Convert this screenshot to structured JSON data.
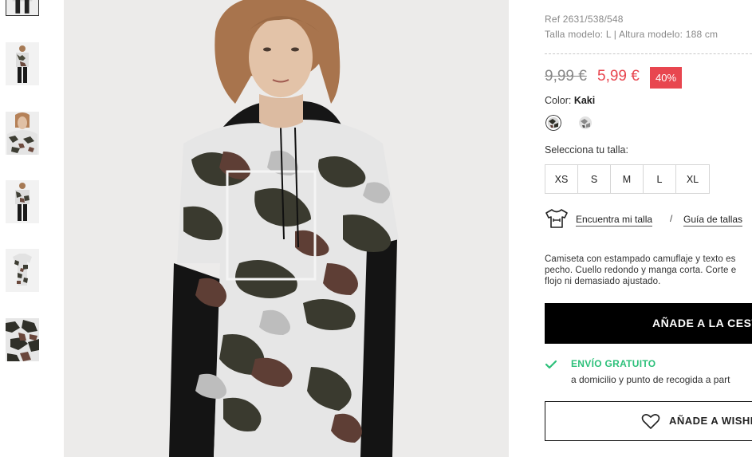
{
  "thumbnails": [
    {
      "name": "thumbnail-1",
      "active": true
    },
    {
      "name": "thumbnail-2",
      "active": false
    },
    {
      "name": "thumbnail-3",
      "active": false
    },
    {
      "name": "thumbnail-4",
      "active": false
    },
    {
      "name": "thumbnail-5",
      "active": false
    },
    {
      "name": "thumbnail-6",
      "active": false
    }
  ],
  "product": {
    "ref": "Ref 2631/538/548",
    "model_info": "Talla modelo: L | Altura modelo: 188 cm",
    "old_price": "9,99 €",
    "new_price": "5,99 €",
    "discount": "40%",
    "color_label": "Color:",
    "color_value": "Kaki",
    "swatches": [
      "camo-kaki-swatch",
      "camo-grey-swatch"
    ],
    "size_label": "Selecciona tu talla:",
    "sizes": [
      "XS",
      "S",
      "M",
      "L",
      "XL"
    ],
    "find_size_link": "Encuentra mi talla",
    "separator": "/",
    "size_guide_link": "Guía de tallas",
    "description_lines": [
      "Camiseta con estampado camuflaje y texto es",
      "pecho. Cuello redondo y manga corta. Corte e",
      "flojo ni demasiado ajustado."
    ],
    "add_to_cart": "AÑADE A LA CESTA",
    "shipping_title": "ENVÍO GRATUITO",
    "shipping_subtitle": "a domicilio y punto de recogida a part",
    "wishlist": "AÑADE A WISHLIST"
  },
  "colors": {
    "price_red": "#e8464f",
    "shipping_green": "#2cc07a",
    "button_black": "#000000"
  }
}
